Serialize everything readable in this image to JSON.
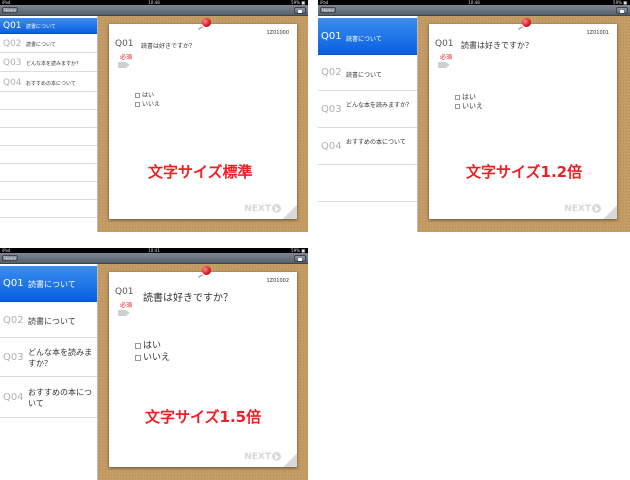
{
  "status": {
    "carrier": "iPad",
    "battery": "59% ■"
  },
  "nav": {
    "home_label": "Home"
  },
  "sidebar_items": [
    {
      "num": "Q01",
      "text": "読書について"
    },
    {
      "num": "Q02",
      "text": "読書について"
    },
    {
      "num": "Q03",
      "text": "どんな本を読みますか？"
    },
    {
      "num": "Q04",
      "text": "おすすめの本について"
    }
  ],
  "question": {
    "num": "Q01",
    "required": "必須",
    "title": "読書は好きですか？",
    "options": [
      "はい",
      "いいえ"
    ],
    "next": "NEXT"
  },
  "screens": [
    {
      "time": "10:48",
      "qid": "1Z01000",
      "caption": "文字サイズ標準"
    },
    {
      "time": "10:48",
      "qid": "1Z01001",
      "caption": "文字サイズ1.2倍"
    },
    {
      "time": "10:41",
      "qid": "1Z01002",
      "caption": "文字サイズ1.5倍"
    }
  ]
}
